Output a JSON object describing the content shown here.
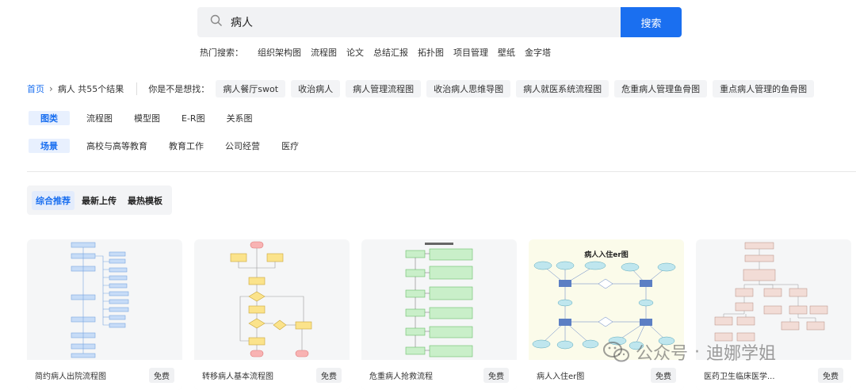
{
  "search": {
    "value": "病人",
    "button_label": "搜索"
  },
  "hot": {
    "label": "热门搜索：",
    "items": [
      "组织架构图",
      "流程图",
      "论文",
      "总结汇报",
      "拓扑图",
      "项目管理",
      "壁纸",
      "金字塔"
    ]
  },
  "breadcrumb": {
    "home": "首页",
    "current": "病人 共55个结果"
  },
  "suggest": {
    "label": "你是不是想找：",
    "tags": [
      "病人餐厅swot",
      "收治病人",
      "病人管理流程图",
      "收治病人思维导图",
      "病人就医系统流程图",
      "危重病人管理鱼骨图",
      "重点病人管理的鱼骨图"
    ]
  },
  "filters": [
    {
      "label": "图类",
      "options": [
        "流程图",
        "模型图",
        "E-R图",
        "关系图"
      ]
    },
    {
      "label": "场景",
      "options": [
        "高校与高等教育",
        "教育工作",
        "公司经营",
        "医疗"
      ]
    }
  ],
  "sort_tabs": [
    "综合推荐",
    "最新上传",
    "最热模板"
  ],
  "cards": [
    {
      "title": "简约病人出院流程图",
      "badge": "免费"
    },
    {
      "title": "转移病人基本流程图",
      "badge": "免费"
    },
    {
      "title": "危重病人抢救流程",
      "badge": "免费"
    },
    {
      "title": "病人入住er图",
      "badge": "免费",
      "thumb_title": "病人入住er图"
    },
    {
      "title": "医药卫生临床医学...",
      "badge": "免费"
    }
  ],
  "watermark": {
    "left": "公众号",
    "right": "迪娜学姐"
  },
  "colors": {
    "accent": "#1a6ff0"
  }
}
